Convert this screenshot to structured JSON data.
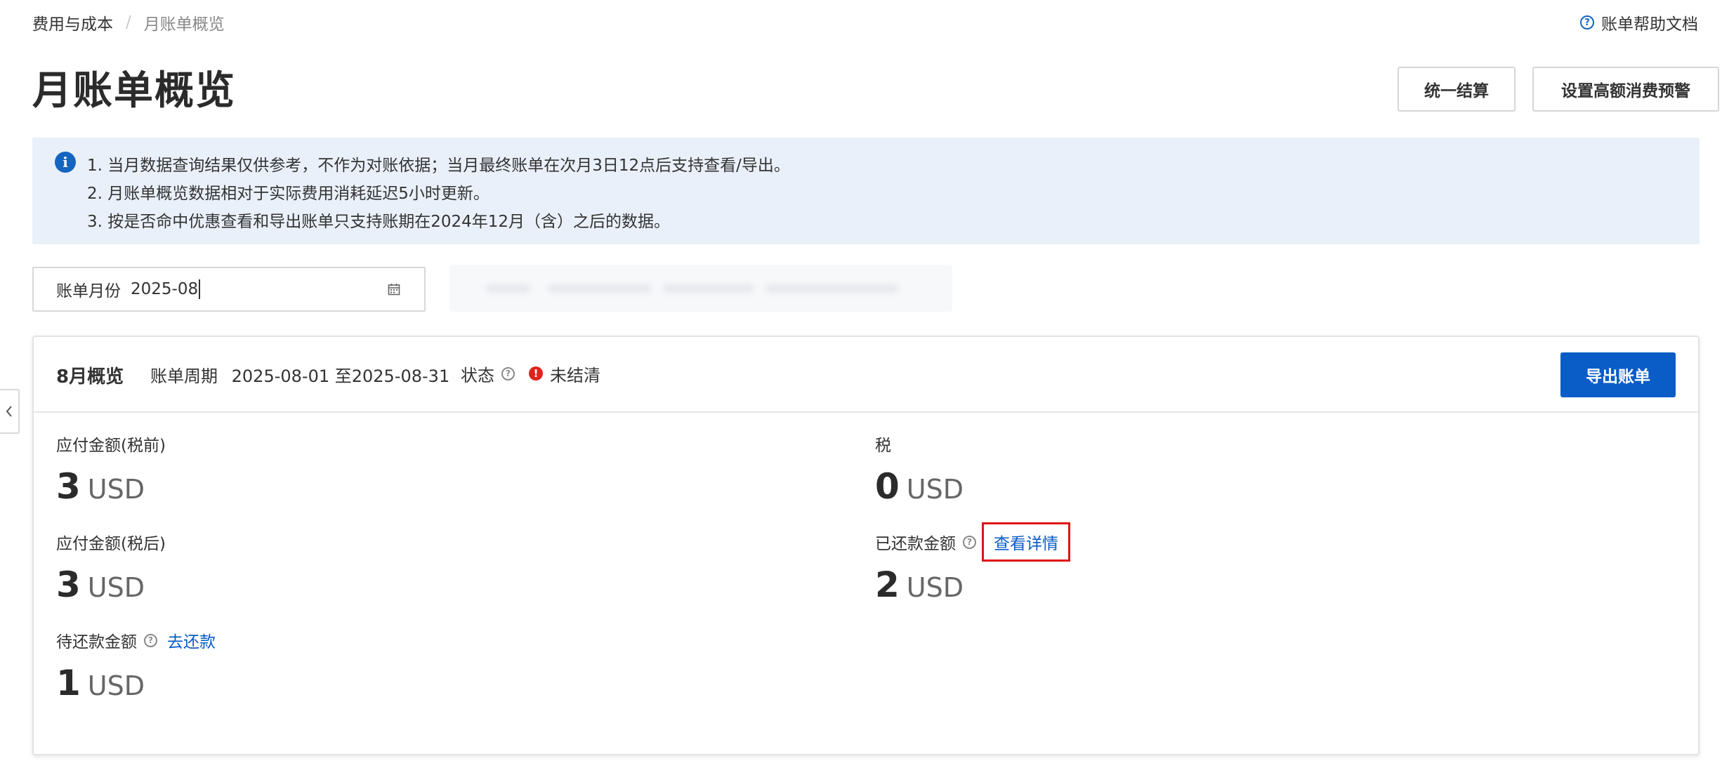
{
  "breadcrumb": {
    "parent": "费用与成本",
    "separator": "/",
    "current": "月账单概览"
  },
  "header": {
    "help_label": "账单帮助文档",
    "title": "月账单概览",
    "settle_button": "统一结算",
    "alert_button": "设置高额消费预警"
  },
  "notice": {
    "icon": "info-icon",
    "lines": [
      "1. 当月数据查询结果仅供参考，不作为对账依据；当月最终账单在次月3日12点后支持查看/导出。",
      "2. 月账单概览数据相对于实际费用消耗延迟5小时更新。",
      "3. 按是否命中优惠查看和导出账单只支持账期在2024年12月（含）之后的数据。"
    ]
  },
  "filter": {
    "month_label": "账单月份",
    "month_value": "2025-08",
    "calendar_icon": "calendar-icon"
  },
  "overview": {
    "title": "8月概览",
    "period_label": "账单周期",
    "period_value": "2025-08-01 至2025-08-31",
    "status_label": "状态",
    "status_value": "未结清",
    "export_button": "导出账单",
    "metrics": {
      "pretax": {
        "label": "应付金额(税前)",
        "value": "3",
        "unit": "USD"
      },
      "tax": {
        "label": "税",
        "value": "0",
        "unit": "USD"
      },
      "aftertax": {
        "label": "应付金额(税后)",
        "value": "3",
        "unit": "USD"
      },
      "paid": {
        "label": "已还款金额",
        "link": "查看详情",
        "value": "2",
        "unit": "USD"
      },
      "pending": {
        "label": "待还款金额",
        "link": "去还款",
        "value": "1",
        "unit": "USD"
      }
    }
  },
  "colors": {
    "accent": "#0a5cc6",
    "notice_bg": "#eaf0fa",
    "status_red": "#e0231d",
    "highlight_red": "#e01414"
  }
}
